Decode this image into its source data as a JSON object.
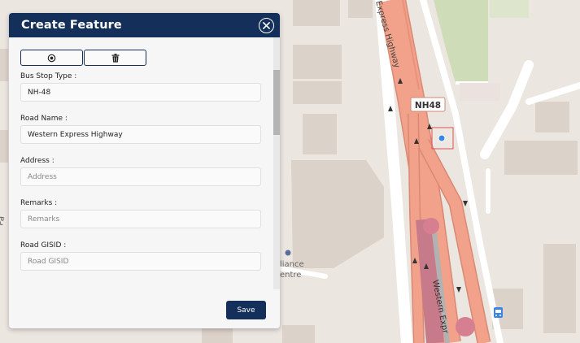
{
  "dialog": {
    "title": "Create Feature",
    "save_label": "Save"
  },
  "form": {
    "bus_stop_type": {
      "label": "Bus Stop Type :",
      "value": "NH-48",
      "placeholder": ""
    },
    "road_name": {
      "label": "Road Name :",
      "value": "Western Express Highway",
      "placeholder": ""
    },
    "address": {
      "label": "Address :",
      "value": "",
      "placeholder": "Address"
    },
    "remarks": {
      "label": "Remarks :",
      "value": "",
      "placeholder": "Remarks"
    },
    "road_gisid": {
      "label": "Road GISID :",
      "value": "",
      "placeholder": "Road GISID"
    }
  },
  "map": {
    "road_label_top": "Express Highway",
    "road_label_bottom": "Western Expr",
    "shield": "NH48",
    "poi_label_1": "liance",
    "poi_label_2": "entre",
    "left_edge_label": "Pa",
    "colors": {
      "road": "#f2a18a",
      "road_edge": "#d88a74",
      "building": "#dbd2c9",
      "park": "#cfdcb8",
      "panel_header": "#14305a",
      "marker": "#3a86e8"
    }
  },
  "icons": [
    "close-icon",
    "target-icon",
    "trash-icon",
    "bus-stop-icon",
    "location-marker-icon"
  ]
}
